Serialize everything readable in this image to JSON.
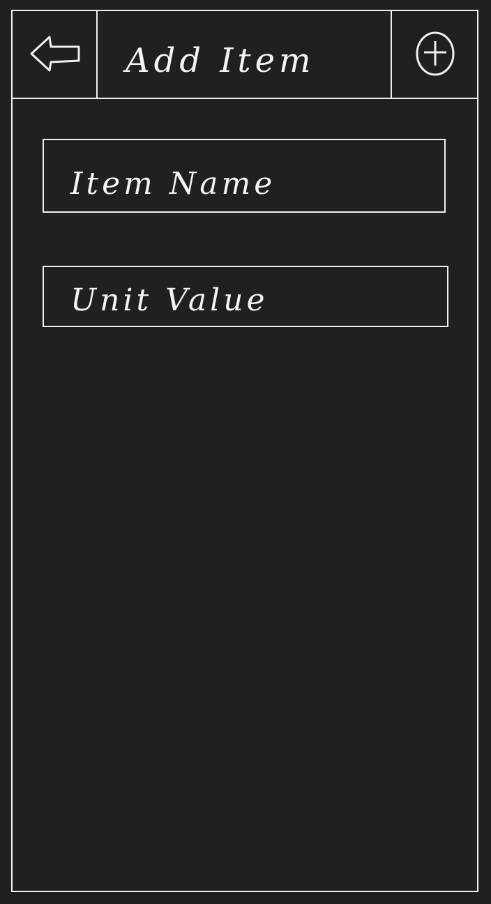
{
  "header": {
    "back_icon": "back-arrow-icon",
    "title": "Add Item",
    "add_icon": "plus-circle-icon"
  },
  "form": {
    "item_name_placeholder": "Item Name",
    "unit_value_placeholder": "Unit Value"
  },
  "colors": {
    "background": "#202020",
    "stroke": "#f0f0f0"
  }
}
